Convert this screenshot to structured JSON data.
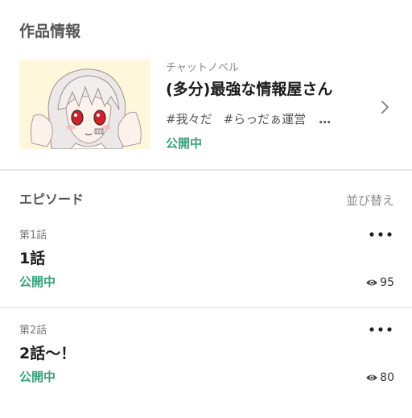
{
  "work_section": {
    "title": "作品情報"
  },
  "work": {
    "category": "チャットノベル",
    "title": "(多分)最強な情報屋さん",
    "tags": [
      "#我々だ",
      "#らっだぁ運営"
    ],
    "tags_more": "…",
    "status": "公開中",
    "status_color": "#37a37a",
    "thumbnail_icon": "anime-character-thumbnail",
    "chevron_icon": "chevron-right-icon"
  },
  "episodes_header": {
    "title": "エピソード",
    "sort_label": "並び替え"
  },
  "episodes": [
    {
      "number": "第1話",
      "title": "1話",
      "status": "公開中",
      "views": "95",
      "menu_icon": "more-horizontal-icon",
      "views_icon": "eye-icon"
    },
    {
      "number": "第2話",
      "title": "2話〜！",
      "status": "公開中",
      "views": "80",
      "menu_icon": "more-horizontal-icon",
      "views_icon": "eye-icon"
    }
  ]
}
